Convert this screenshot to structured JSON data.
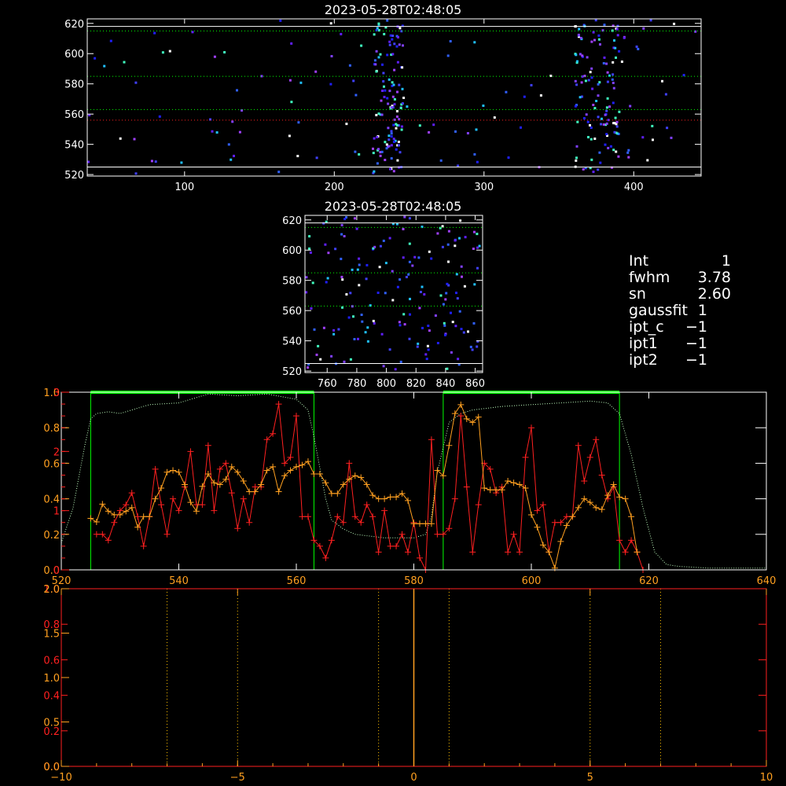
{
  "colors": {
    "white": "#ffffff",
    "red": "#ff2020",
    "orange": "#ffa020",
    "green": "#00ff00",
    "gold": "#ffc000",
    "lightgreen": "#c0ffc0"
  },
  "top_panel": {
    "title": "2023-05-28T02:48:05",
    "xlim": [
      35,
      445
    ],
    "ylim": [
      519,
      623
    ],
    "xticks": [
      100,
      200,
      300,
      400
    ],
    "yticks": [
      520,
      540,
      560,
      580,
      600,
      620
    ],
    "hlines_white": [
      525,
      618
    ],
    "hlines_green": [
      615,
      585,
      563
    ],
    "hlines_red": [
      556
    ],
    "clusters": [
      [
        225,
        245
      ],
      [
        360,
        390
      ]
    ]
  },
  "mid_panel": {
    "title": "2023-05-28T02:48:05",
    "xlim": [
      745,
      865
    ],
    "ylim": [
      519,
      623
    ],
    "xticks": [
      760,
      780,
      800,
      820,
      840,
      860
    ],
    "yticks": [
      520,
      540,
      560,
      580,
      600,
      620
    ],
    "hlines_white": [
      525,
      618
    ],
    "hlines_green": [
      615,
      585,
      563
    ]
  },
  "info": [
    {
      "key": "Int",
      "val": "1"
    },
    {
      "key": "fwhm",
      "val": "3.78"
    },
    {
      "key": "sn",
      "val": "2.60"
    },
    {
      "key": "gaussfit",
      "val": "1"
    },
    {
      "key": "ipt_c",
      "val": "−1"
    },
    {
      "key": "ipt1",
      "val": "−1"
    },
    {
      "key": "ipt2",
      "val": "−1"
    }
  ],
  "chart_data": [
    {
      "type": "line",
      "title": "",
      "xlim": [
        520,
        640
      ],
      "xticks": [
        520,
        540,
        560,
        580,
        600,
        620,
        640
      ],
      "left_axis_white": {
        "ylim": [
          0,
          1
        ],
        "ticks": [
          0.0,
          0.2,
          0.4,
          0.6,
          0.8,
          1.0
        ],
        "labels": [
          "0.0",
          "0.2",
          "0.4",
          "0.6",
          "0.8",
          "1.0"
        ]
      },
      "left_axis_red": {
        "ylim": [
          0,
          3
        ],
        "ticks": [
          0,
          1,
          2,
          3
        ],
        "labels": [
          "0",
          "1",
          "2",
          "3"
        ]
      },
      "left_axis_orange": {
        "ylim": [
          0,
          1
        ],
        "ticks": [
          0.0,
          0.2,
          0.4,
          0.6,
          0.8,
          1.0
        ],
        "labels": [
          "0.0",
          "0.2",
          "0.4",
          "0.6",
          "0.8",
          "1.0"
        ]
      },
      "windows": [
        [
          525,
          563
        ],
        [
          585,
          615
        ]
      ],
      "red_series": {
        "x": [
          526,
          527,
          528,
          529,
          530,
          531,
          532,
          533,
          534,
          535,
          536,
          537,
          538,
          539,
          540,
          541,
          542,
          543,
          544,
          545,
          546,
          547,
          548,
          549,
          550,
          551,
          552,
          553,
          554,
          555,
          556,
          557,
          558,
          559,
          560,
          561,
          562,
          563,
          564,
          565,
          566,
          567,
          568,
          569,
          570,
          571,
          572,
          573,
          574,
          575,
          576,
          577,
          578,
          579,
          580,
          581,
          582,
          583,
          584,
          585,
          586,
          587,
          588,
          589,
          590,
          591,
          592,
          593,
          594,
          595,
          596,
          597,
          598,
          599,
          600,
          601,
          602,
          603,
          604,
          605,
          606,
          607,
          608,
          609,
          610,
          611,
          612,
          613,
          614,
          615,
          616,
          617,
          618,
          619
        ],
        "y": [
          0.6,
          0.6,
          0.5,
          0.8,
          1.0,
          1.1,
          1.3,
          0.9,
          0.4,
          0.9,
          1.7,
          1.1,
          0.6,
          1.2,
          1.0,
          1.4,
          2.0,
          1.1,
          1.1,
          2.1,
          1.0,
          1.7,
          1.8,
          1.3,
          0.7,
          1.2,
          0.8,
          1.4,
          1.4,
          2.2,
          2.3,
          2.8,
          1.8,
          1.9,
          2.6,
          0.9,
          0.9,
          0.5,
          0.4,
          0.2,
          0.5,
          0.9,
          0.8,
          1.8,
          0.9,
          0.8,
          1.1,
          0.9,
          0.3,
          1.0,
          0.4,
          0.4,
          0.6,
          0.3,
          0.8,
          0.2,
          0.0,
          2.2,
          0.6,
          0.6,
          0.7,
          1.2,
          2.6,
          1.4,
          0.3,
          1.1,
          1.8,
          1.7,
          1.3,
          1.4,
          0.3,
          0.6,
          0.3,
          1.9,
          2.4,
          1.0,
          1.1,
          0.3,
          0.8,
          0.8,
          0.9,
          0.9,
          2.1,
          1.5,
          1.9,
          2.2,
          1.6,
          1.2,
          1.4,
          0.5,
          0.3,
          0.5,
          0.3,
          0.0
        ]
      },
      "orange_series": {
        "x": [
          525,
          526,
          527,
          528,
          529,
          530,
          531,
          532,
          533,
          534,
          535,
          536,
          537,
          538,
          539,
          540,
          541,
          542,
          543,
          544,
          545,
          546,
          547,
          548,
          549,
          550,
          551,
          552,
          553,
          554,
          555,
          556,
          557,
          558,
          559,
          560,
          561,
          562,
          563,
          564,
          565,
          566,
          567,
          568,
          569,
          570,
          571,
          572,
          573,
          574,
          575,
          576,
          577,
          578,
          579,
          580,
          581,
          582,
          583,
          584,
          585,
          586,
          587,
          588,
          589,
          590,
          591,
          592,
          593,
          594,
          595,
          596,
          597,
          598,
          599,
          600,
          601,
          602,
          603,
          604,
          605,
          606,
          607,
          608,
          609,
          610,
          611,
          612,
          613,
          614,
          615,
          616,
          617,
          618
        ],
        "y": [
          0.29,
          0.27,
          0.37,
          0.33,
          0.31,
          0.31,
          0.33,
          0.35,
          0.24,
          0.3,
          0.3,
          0.4,
          0.46,
          0.55,
          0.56,
          0.55,
          0.48,
          0.38,
          0.33,
          0.47,
          0.54,
          0.49,
          0.48,
          0.51,
          0.58,
          0.55,
          0.5,
          0.44,
          0.44,
          0.48,
          0.56,
          0.58,
          0.44,
          0.53,
          0.56,
          0.58,
          0.59,
          0.61,
          0.54,
          0.54,
          0.49,
          0.43,
          0.43,
          0.48,
          0.51,
          0.53,
          0.52,
          0.48,
          0.42,
          0.4,
          0.4,
          0.41,
          0.41,
          0.43,
          0.39,
          0.26,
          0.26,
          0.26,
          0.26,
          0.56,
          0.53,
          0.7,
          0.88,
          0.93,
          0.85,
          0.83,
          0.86,
          0.46,
          0.45,
          0.45,
          0.45,
          0.5,
          0.49,
          0.48,
          0.46,
          0.31,
          0.24,
          0.14,
          0.1,
          0.01,
          0.16,
          0.25,
          0.3,
          0.35,
          0.4,
          0.38,
          0.35,
          0.34,
          0.42,
          0.48,
          0.41,
          0.4,
          0.3,
          0.1
        ]
      },
      "dotted_profile": {
        "x": [
          520,
          522,
          524,
          525,
          526,
          528,
          530,
          535,
          540,
          545,
          550,
          555,
          560,
          562,
          563,
          565,
          566,
          568,
          570,
          575,
          578,
          580,
          582,
          583,
          584,
          586,
          588,
          590,
          595,
          600,
          605,
          610,
          613,
          615,
          617,
          619,
          621,
          623,
          625,
          630,
          635,
          640
        ],
        "y": [
          0.15,
          0.35,
          0.7,
          0.85,
          0.88,
          0.89,
          0.88,
          0.93,
          0.94,
          0.99,
          0.98,
          0.99,
          0.96,
          0.9,
          0.75,
          0.4,
          0.28,
          0.23,
          0.2,
          0.18,
          0.18,
          0.18,
          0.2,
          0.3,
          0.55,
          0.83,
          0.88,
          0.9,
          0.92,
          0.93,
          0.94,
          0.95,
          0.94,
          0.88,
          0.65,
          0.35,
          0.1,
          0.03,
          0.02,
          0.01,
          0.01,
          0.01
        ]
      }
    },
    {
      "type": "line",
      "title": "",
      "xlim": [
        -10,
        10
      ],
      "xticks": [
        -10,
        -5,
        0,
        5,
        10
      ],
      "left_axis_white": {
        "ylim": [
          0,
          1
        ],
        "ticks": [
          0.0,
          0.2,
          0.4,
          0.6,
          0.8,
          1.0
        ],
        "labels": [
          "0.0",
          "0.2",
          "0.4",
          "0.6",
          "0.8",
          "1.0"
        ]
      },
      "left_axis_orange": {
        "ylim": [
          0,
          2
        ],
        "ticks": [
          0.0,
          0.5,
          1.0,
          1.5,
          2.0
        ],
        "labels": [
          "0.0",
          "0.5",
          "1.0",
          "1.5",
          "2.0"
        ]
      },
      "vlines_dotted_white": [
        -7,
        -5,
        -1,
        1,
        5,
        7
      ],
      "vline_orange": 0
    }
  ]
}
